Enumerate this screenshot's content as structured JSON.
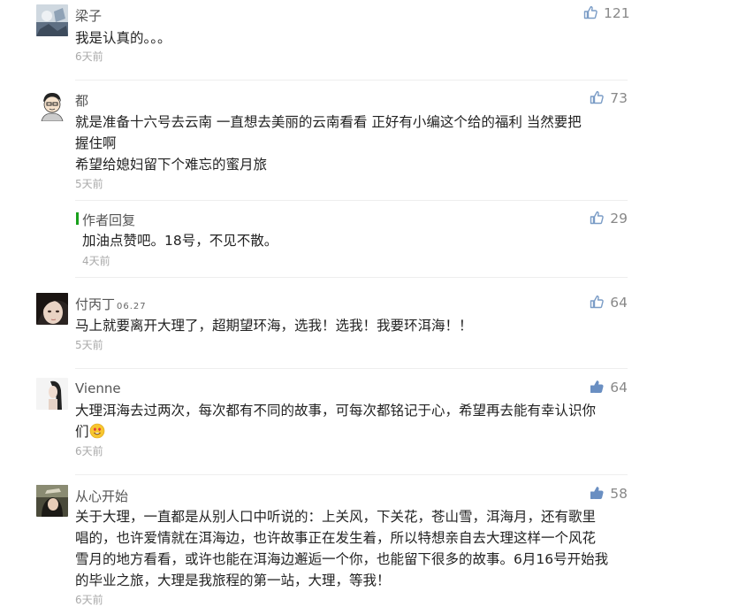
{
  "comments": [
    {
      "user": "梁子",
      "likes": "121",
      "lines": [
        "我是认真的。。。"
      ],
      "time": "6天前"
    },
    {
      "user": "都",
      "likes": "73",
      "lines": [
        "就是准备十六号去云南  一直想去美丽的云南看看  正好有小编这个给的福利   当然要把",
        "握住啊",
        "希望给媳妇留下个难忘的蜜月旅"
      ],
      "time": "5天前",
      "reply": {
        "label": "作者回复",
        "likes": "29",
        "text": "加油点赞吧。18号，不见不散。",
        "time": "4天前"
      }
    },
    {
      "user": "付丙丁",
      "user_date": "06.27",
      "likes": "64",
      "lines": [
        "马上就要离开大理了，超期望环海，选我！选我！我要环洱海！！"
      ],
      "time": "5天前"
    },
    {
      "user": "Vienne",
      "likes": "64",
      "lines": [
        "大理洱海去过两次，每次都有不同的故事，可每次都铭记于心，希望再去能有幸认识你",
        "们"
      ],
      "emoji": "heart-eyes",
      "time": "6天前"
    },
    {
      "user": "从心开始",
      "likes": "58",
      "lines": [
        "关于大理，一直都是从别人口中听说的：上关风，下关花，苍山雪，洱海月，还有歌里",
        "唱的，也许爱情就在洱海边，也许故事正在发生着，所以特想亲自去大理这样一个风花",
        "雪月的地方看看，或许也能在洱海边邂逅一个你，也能留下很多的故事。6月16号开始我",
        "的毕业之旅，大理是我旅程的第一站，大理，等我！"
      ],
      "time": "6天前"
    }
  ],
  "icons": {
    "like": "thumbs-up-icon",
    "emoji": "heart-eyes-emoji-icon"
  },
  "colors": {
    "like_outline": "#7a9cc6",
    "like_filled": "#6a8fc2",
    "reply_accent": "#19a01c",
    "time": "#aaaaaa"
  }
}
